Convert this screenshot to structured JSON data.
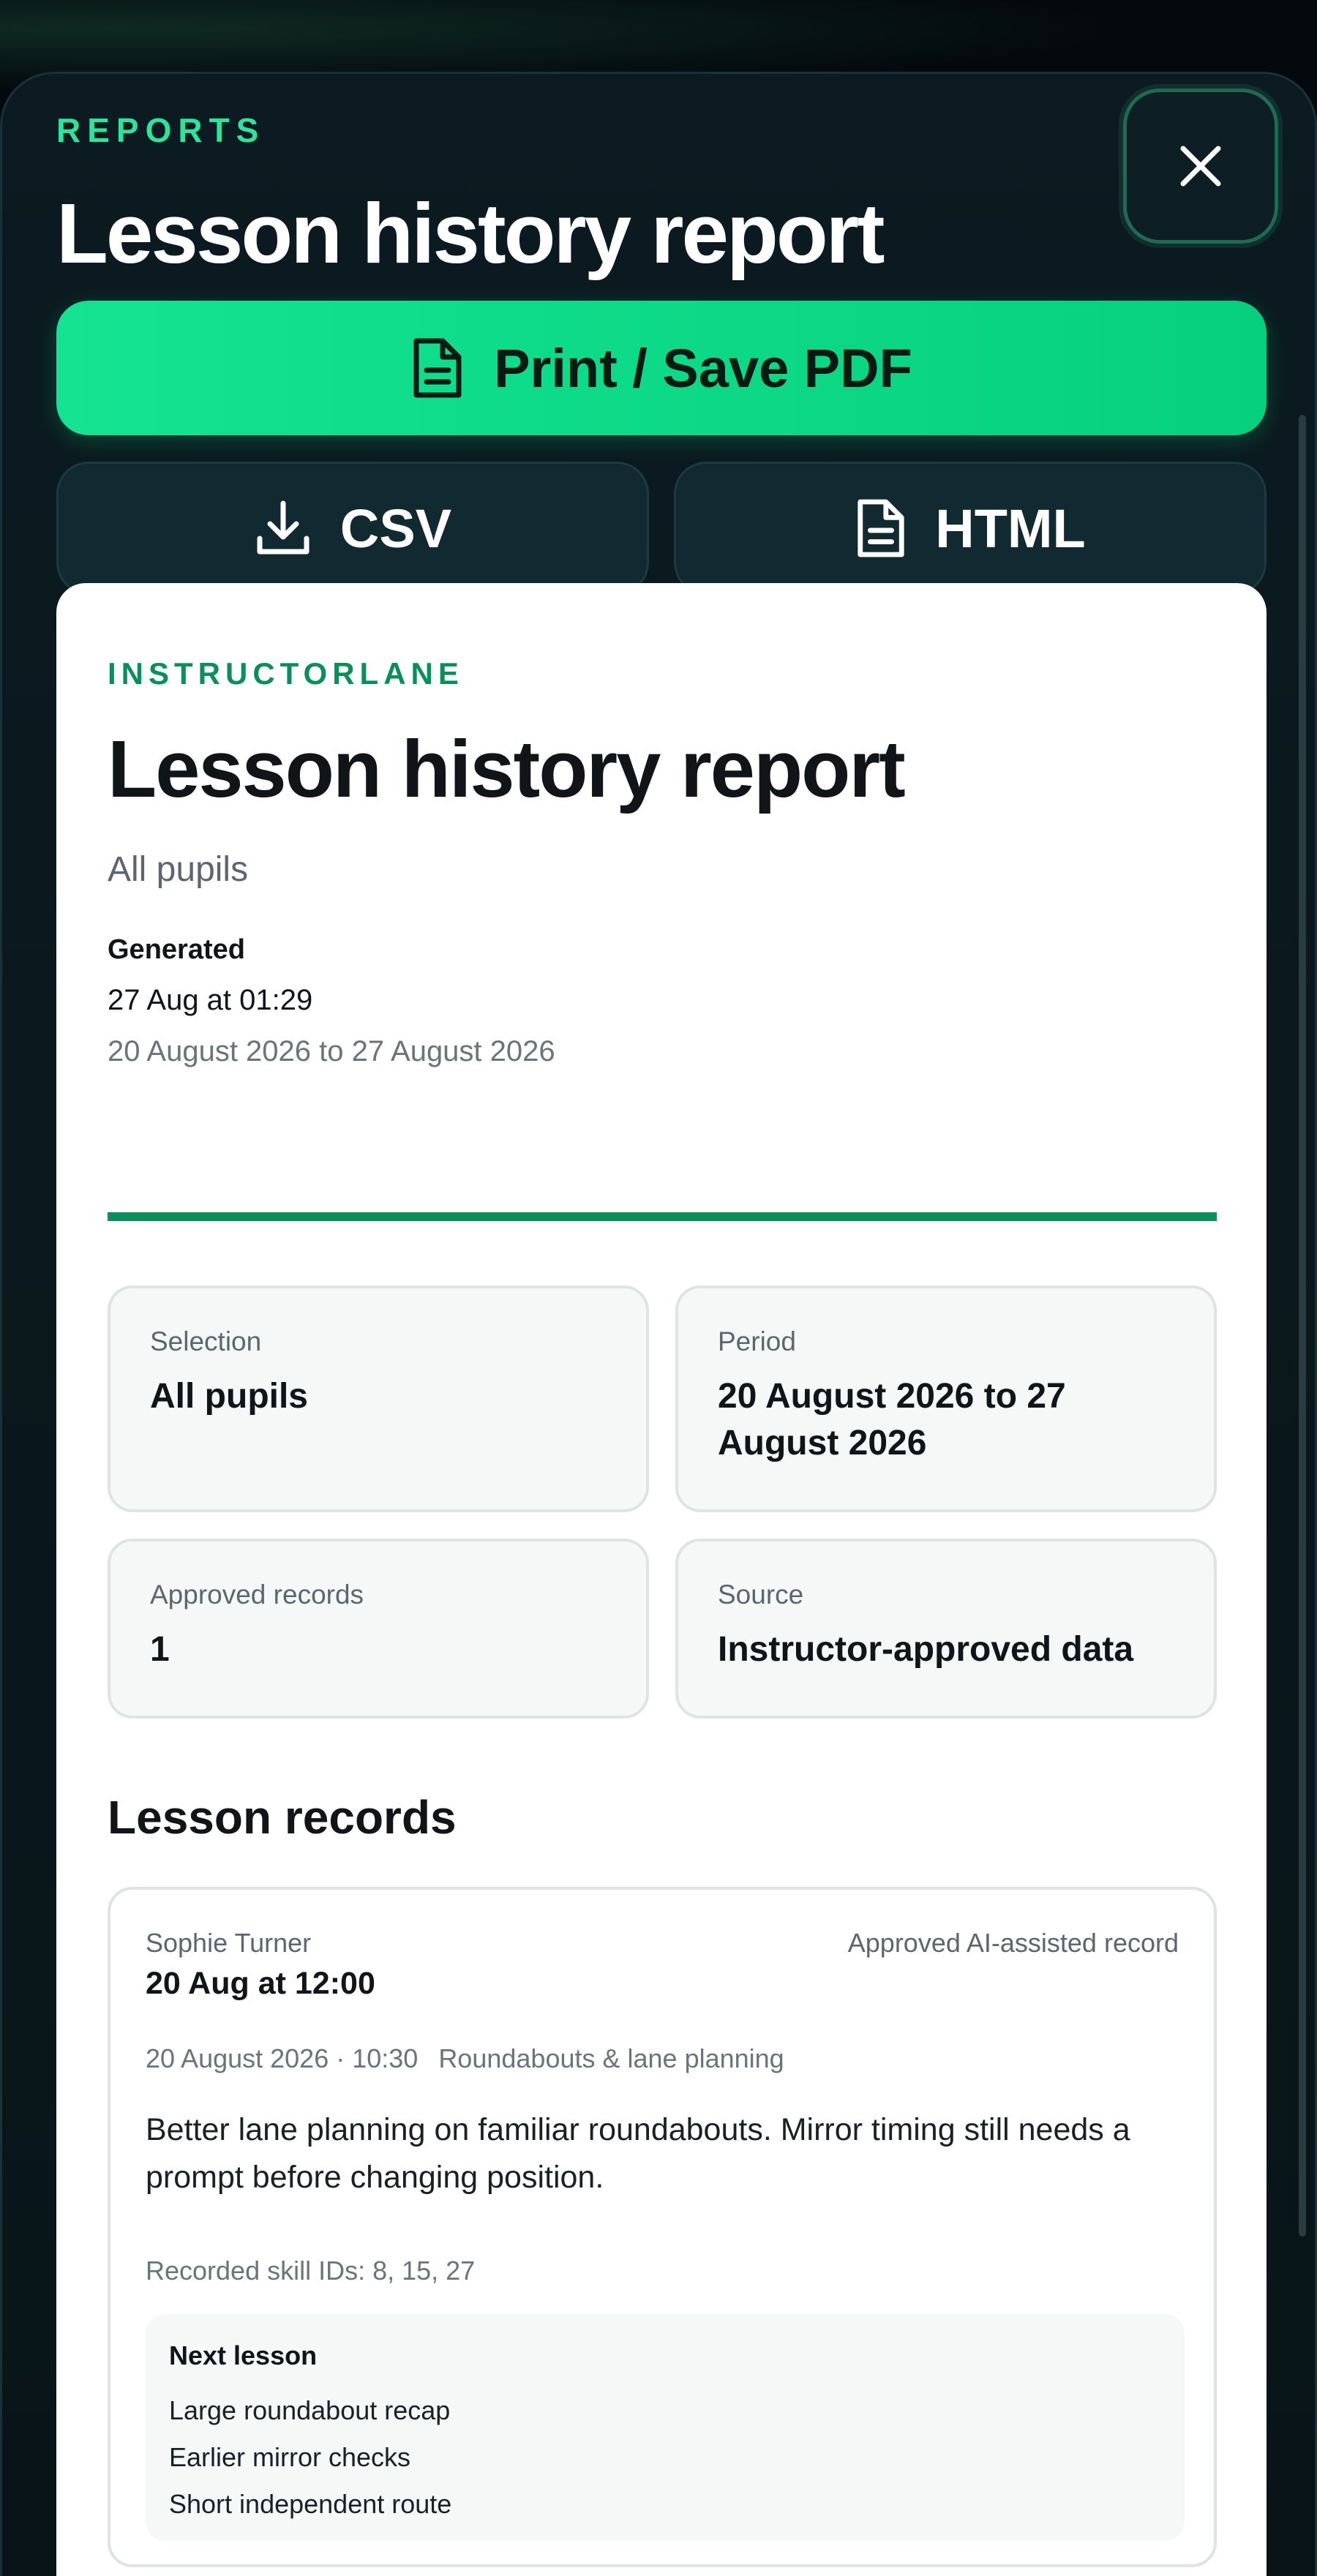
{
  "header": {
    "eyebrow": "REPORTS",
    "title": "Lesson history report"
  },
  "actions": {
    "print_label": "Print / Save PDF",
    "csv_label": "CSV",
    "html_label": "HTML"
  },
  "report": {
    "brand": "INSTRUCTORLANE",
    "title": "Lesson history report",
    "subtitle": "All pupils",
    "generated_label": "Generated",
    "generated_time": "27 Aug at 01:29",
    "range": "20 August 2026 to 27 August 2026",
    "cards": [
      {
        "key": "Selection",
        "value": "All pupils"
      },
      {
        "key": "Period",
        "value": "20 August 2026 to 27 August 2026"
      },
      {
        "key": "Approved records",
        "value": "1"
      },
      {
        "key": "Source",
        "value": "Instructor-approved data"
      }
    ],
    "records_title": "Lesson records",
    "records": [
      {
        "pupil": "Sophie Turner",
        "date": "20 Aug at 12:00",
        "status": "Approved AI-assisted record",
        "meta_date": "20 August 2026 · 10:30",
        "topic": "Roundabouts & lane planning",
        "notes": "Better lane planning on familiar roundabouts. Mirror timing still needs a prompt before changing position.",
        "skills": "Recorded skill IDs: 8, 15, 27",
        "next_label": "Next lesson",
        "next_items": [
          "Large roundabout recap",
          "Earlier mirror checks",
          "Short independent route"
        ]
      }
    ]
  },
  "colors": {
    "accent": "#2fe39a",
    "primary_button": "#14e391",
    "brand_green": "#0a8f5c",
    "sheet_bg": "#0b1b21"
  },
  "icons": {
    "close": "close-icon",
    "print": "document-icon",
    "csv": "download-icon",
    "html": "document-icon"
  }
}
